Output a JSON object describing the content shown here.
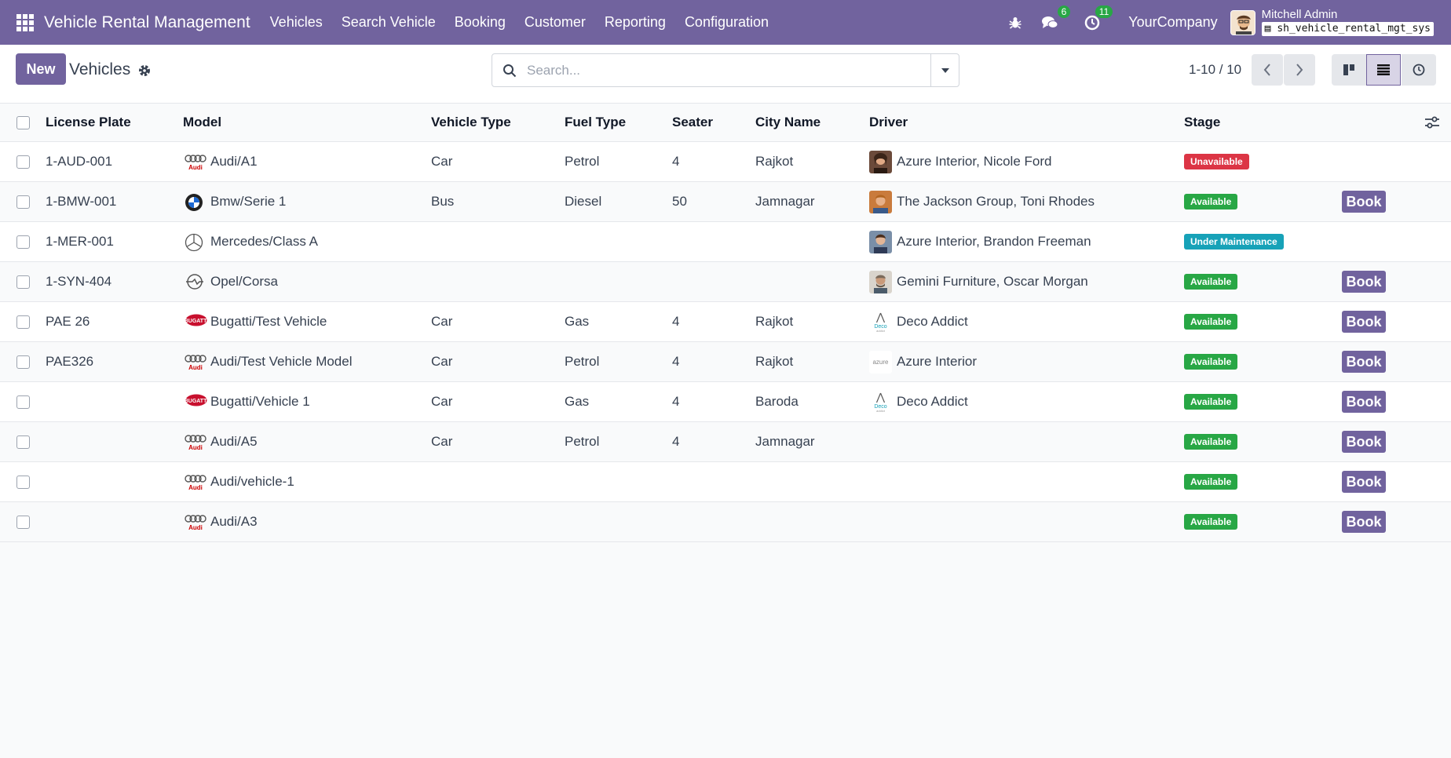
{
  "navbar": {
    "app_title": "Vehicle Rental Management",
    "menu": [
      "Vehicles",
      "Search Vehicle",
      "Booking",
      "Customer",
      "Reporting",
      "Configuration"
    ],
    "messages_count": "6",
    "activities_count": "11",
    "company": "YourCompany",
    "user_name": "Mitchell Admin",
    "database": "sh_vehicle_rental_mgt_sys"
  },
  "control": {
    "new_label": "New",
    "breadcrumb": "Vehicles",
    "search_placeholder": "Search...",
    "pager": "1-10 / 10"
  },
  "table": {
    "columns": [
      "License Plate",
      "Model",
      "Vehicle Type",
      "Fuel Type",
      "Seater",
      "City Name",
      "Driver",
      "Stage"
    ],
    "book_label": "Book",
    "rows": [
      {
        "plate": "1-AUD-001",
        "model": "Audi/A1",
        "logo": "audi",
        "type": "Car",
        "fuel": "Petrol",
        "seater": "4",
        "city": "Rajkot",
        "driver": "Azure Interior, Nicole Ford",
        "driver_img": "person1",
        "stage": "Unavailable",
        "stage_kind": "unavail",
        "book": false
      },
      {
        "plate": "1-BMW-001",
        "model": "Bmw/Serie 1",
        "logo": "bmw",
        "type": "Bus",
        "fuel": "Diesel",
        "seater": "50",
        "city": "Jamnagar",
        "driver": "The Jackson Group, Toni Rhodes",
        "driver_img": "person2",
        "stage": "Available",
        "stage_kind": "avail",
        "book": true
      },
      {
        "plate": "1-MER-001",
        "model": "Mercedes/Class A",
        "logo": "mercedes",
        "type": "",
        "fuel": "",
        "seater": "",
        "city": "",
        "driver": "Azure Interior, Brandon Freeman",
        "driver_img": "person3",
        "stage": "Under Maintenance",
        "stage_kind": "maint",
        "book": false
      },
      {
        "plate": "1-SYN-404",
        "model": "Opel/Corsa",
        "logo": "opel",
        "type": "",
        "fuel": "",
        "seater": "",
        "city": "",
        "driver": "Gemini Furniture, Oscar Morgan",
        "driver_img": "person4",
        "stage": "Available",
        "stage_kind": "avail",
        "book": true
      },
      {
        "plate": "PAE 26",
        "model": "Bugatti/Test Vehicle",
        "logo": "bugatti",
        "type": "Car",
        "fuel": "Gas",
        "seater": "4",
        "city": "Rajkot",
        "driver": "Deco Addict",
        "driver_img": "deco",
        "stage": "Available",
        "stage_kind": "avail",
        "book": true
      },
      {
        "plate": "PAE326",
        "model": "Audi/Test Vehicle Model",
        "logo": "audi",
        "type": "Car",
        "fuel": "Petrol",
        "seater": "4",
        "city": "Rajkot",
        "driver": "Azure Interior",
        "driver_img": "azure",
        "stage": "Available",
        "stage_kind": "avail",
        "book": true
      },
      {
        "plate": "",
        "model": "Bugatti/Vehicle 1",
        "logo": "bugatti",
        "type": "Car",
        "fuel": "Gas",
        "seater": "4",
        "city": "Baroda",
        "driver": "Deco Addict",
        "driver_img": "deco",
        "stage": "Available",
        "stage_kind": "avail",
        "book": true
      },
      {
        "plate": "",
        "model": "Audi/A5",
        "logo": "audi",
        "type": "Car",
        "fuel": "Petrol",
        "seater": "4",
        "city": "Jamnagar",
        "driver": "",
        "driver_img": "",
        "stage": "Available",
        "stage_kind": "avail",
        "book": true
      },
      {
        "plate": "",
        "model": "Audi/vehicle-1",
        "logo": "audi",
        "type": "",
        "fuel": "",
        "seater": "",
        "city": "",
        "driver": "",
        "driver_img": "",
        "stage": "Available",
        "stage_kind": "avail",
        "book": true
      },
      {
        "plate": "",
        "model": "Audi/A3",
        "logo": "audi",
        "type": "",
        "fuel": "",
        "seater": "",
        "city": "",
        "driver": "",
        "driver_img": "",
        "stage": "Available",
        "stage_kind": "avail",
        "book": true
      }
    ]
  },
  "colors": {
    "primary": "#71639e",
    "available": "#28a745",
    "unavailable": "#dc3545",
    "maintenance": "#17a2b8"
  }
}
